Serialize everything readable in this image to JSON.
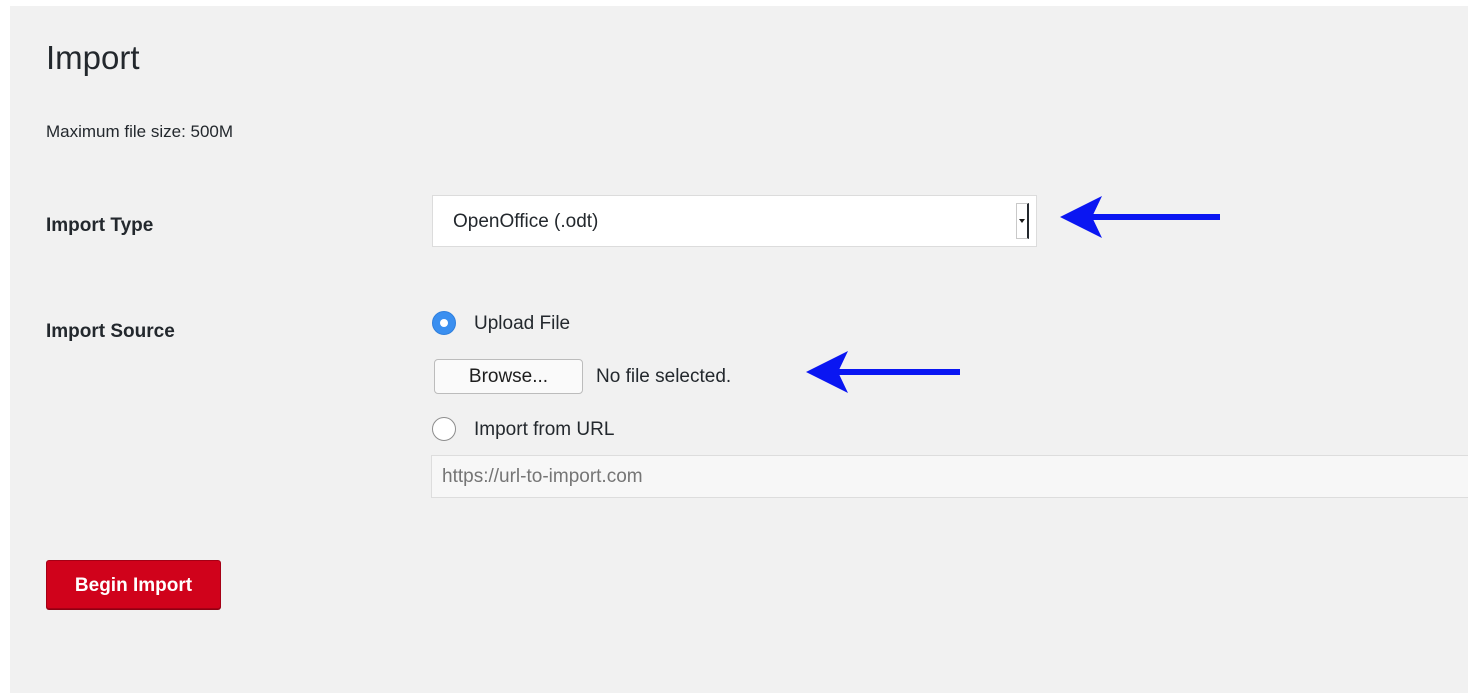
{
  "page": {
    "title": "Import",
    "max_file_size": "Maximum file size: 500M"
  },
  "import_type": {
    "label": "Import Type",
    "selected": "OpenOffice (.odt)"
  },
  "import_source": {
    "label": "Import Source",
    "options": [
      {
        "label": "Upload File",
        "checked": true
      },
      {
        "label": "Import from URL",
        "checked": false
      }
    ],
    "browse_label": "Browse...",
    "file_status": "No file selected.",
    "url_placeholder": "https://url-to-import.com"
  },
  "actions": {
    "begin_label": "Begin Import"
  },
  "colors": {
    "panel_background": "#f1f1f1",
    "primary_button": "#d0021b",
    "radio_accent": "#3a8ff0",
    "annotation_arrow": "#0a16f2"
  },
  "annotations": [
    {
      "icon": "arrow-left-icon",
      "points_to": "import-type-select"
    },
    {
      "icon": "arrow-left-icon",
      "points_to": "file-status"
    }
  ]
}
